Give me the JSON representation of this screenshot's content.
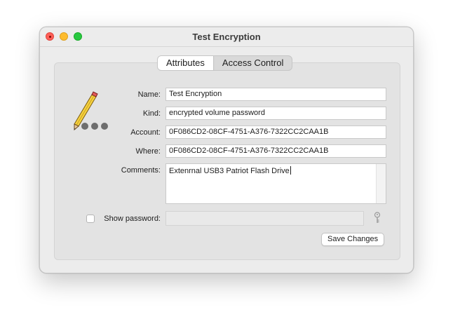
{
  "window": {
    "title": "Test Encryption"
  },
  "tabs": [
    {
      "label": "Attributes",
      "active": true
    },
    {
      "label": "Access Control",
      "active": false
    }
  ],
  "form": {
    "name_label": "Name:",
    "name_value": "Test Encryption",
    "kind_label": "Kind:",
    "kind_value": "encrypted volume password",
    "account_label": "Account:",
    "account_value": "0F086CD2-08CF-4751-A376-7322CC2CAA1B",
    "where_label": "Where:",
    "where_value": "0F086CD2-08CF-4751-A376-7322CC2CAA1B",
    "comments_label": "Comments:",
    "comments_value": "Extenrnal USB3 Patriot Flash Drive",
    "show_password_label": "Show password:",
    "show_password_checked": false,
    "password_value": ""
  },
  "buttons": {
    "save_changes": "Save Changes"
  },
  "icons": {
    "item": "pencil-icon",
    "key": "key-icon"
  },
  "colors": {
    "close": "#fe5f57",
    "minimize": "#febc2e",
    "maximize": "#28c840"
  }
}
